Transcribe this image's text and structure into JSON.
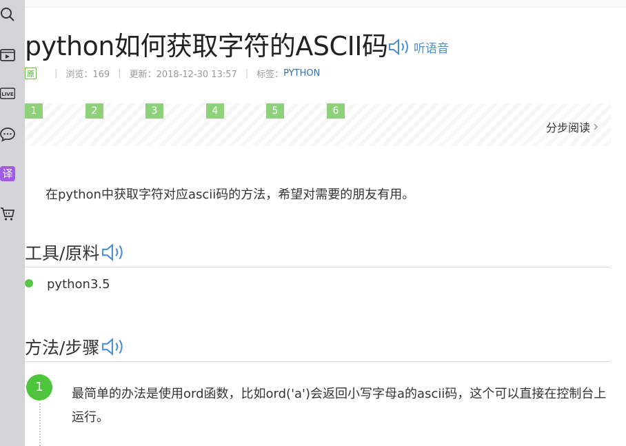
{
  "sidebar": {
    "icons": [
      "search-icon",
      "video-icon",
      "live-icon",
      "chat-icon",
      "translate-icon",
      "cart-icon"
    ],
    "live_label": "LIVE",
    "translate_label": "译",
    "translate_color": "#a05ae6"
  },
  "article": {
    "title": "python如何获取字符的ASCII码",
    "listen_label": "听语音",
    "meta": {
      "original_badge": "原",
      "views": "浏览：169",
      "updated": "更新：2018-12-30 13:57",
      "tag_label": "标签：",
      "tag": "PYTHON"
    },
    "step_nav": {
      "steps": [
        "1",
        "2",
        "3",
        "4",
        "5",
        "6"
      ],
      "read_label": "分步阅读"
    },
    "intro": "在python中获取字符对应ascii码的方法，希望对需要的朋友有用。",
    "tools": {
      "heading": "工具/原料",
      "items": [
        "python3.5"
      ]
    },
    "method": {
      "heading": "方法/步骤",
      "steps": [
        {
          "number": "1",
          "text": "最简单的办法是使用ord函数，比如ord('a')会返回小写字母a的ascii码，这个可以直接在控制台上运行。"
        }
      ]
    }
  },
  "colors": {
    "accent_green": "#4fc43d",
    "step_box_green": "#8fd17a",
    "link_blue": "#4a8fd8",
    "tag_blue": "#3a6ea8"
  }
}
